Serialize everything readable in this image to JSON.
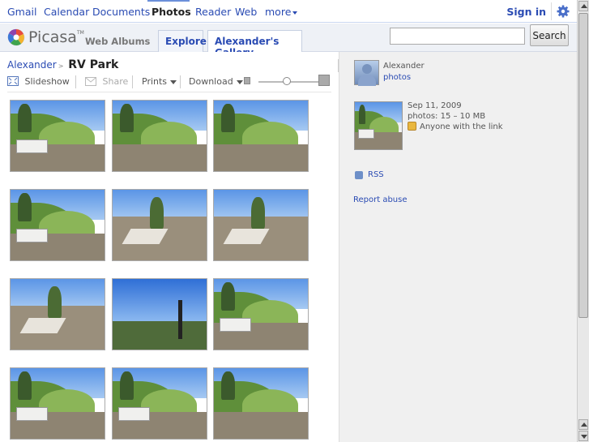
{
  "gbar": {
    "links": [
      "Gmail",
      "Calendar",
      "Documents",
      "Photos",
      "Reader",
      "Web",
      "more"
    ],
    "signin": "Sign in"
  },
  "header": {
    "logo_text": "Picasa",
    "logo_tm": "TM",
    "logo_sub": "Web Albums",
    "tabs": [
      "Explore",
      "Alexander's Gallery"
    ],
    "search_button": "Search",
    "search_value": ""
  },
  "breadcrumb": {
    "owner": "Alexander",
    "album": "RV Park"
  },
  "toolbar": {
    "slideshow": "Slideshow",
    "share": "Share",
    "prints": "Prints",
    "download": "Download",
    "thumb_zoom_level": 0.45
  },
  "sidebar": {
    "owner_name": "Alexander",
    "owner_photos": "photos",
    "album_date": "Sep 11, 2009",
    "album_count": "photos: 15 – 10 MB",
    "album_share": "Anyone with the link",
    "rss": "RSS",
    "report": "Report abuse"
  },
  "photos": [
    {
      "variant": "rv-hill"
    },
    {
      "variant": "hill-road"
    },
    {
      "variant": "hill-road"
    },
    {
      "variant": "rv-hill"
    },
    {
      "variant": "pad-tree"
    },
    {
      "variant": "pad-palm"
    },
    {
      "variant": "pad-tree"
    },
    {
      "variant": "lamp"
    },
    {
      "variant": "rv-hill"
    },
    {
      "variant": "rv-hill"
    },
    {
      "variant": "rv-hill"
    },
    {
      "variant": "hill-road"
    }
  ]
}
